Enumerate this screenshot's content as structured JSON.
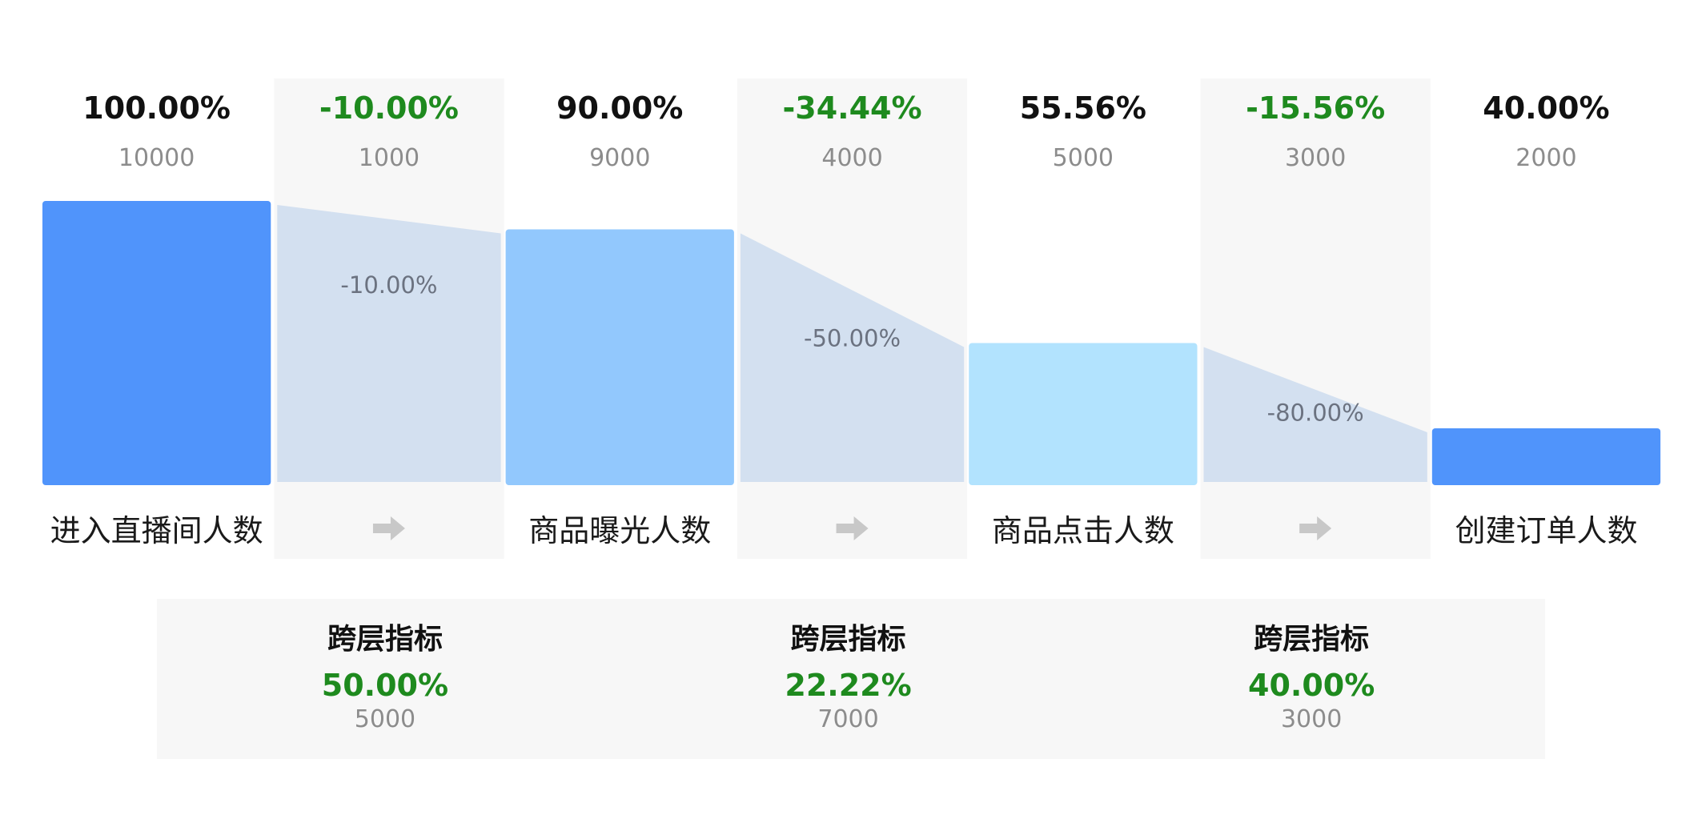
{
  "colors": {
    "green": "#1e8a1e",
    "black": "#111111",
    "panel": "#f7f7f7",
    "connector": "#d3e0f0",
    "arrow": "#c8c8c8",
    "stage_bars": [
      "#5094fb",
      "#92c8fd",
      "#b2e3fe",
      "#5094fb"
    ]
  },
  "chart_data": {
    "type": "funnel",
    "stages": [
      {
        "label": "进入直播间人数",
        "percent": "100.00%",
        "count": 10000,
        "value": 10000
      },
      {
        "label": "商品曝光人数",
        "percent": "90.00%",
        "count": 9000,
        "value": 9000
      },
      {
        "label": "商品点击人数",
        "percent": "55.56%",
        "count": 5000,
        "value": 5000
      },
      {
        "label": "创建订单人数",
        "percent": "40.00%",
        "count": 2000,
        "value": 2000
      }
    ],
    "transitions": [
      {
        "percent": "-10.00%",
        "count": 1000,
        "conversion": "-10.00%",
        "arrow_icon": "arrow-right-icon"
      },
      {
        "percent": "-34.44%",
        "count": 4000,
        "conversion": "-50.00%",
        "arrow_icon": "arrow-right-icon"
      },
      {
        "percent": "-15.56%",
        "count": 3000,
        "conversion": "-80.00%",
        "arrow_icon": "arrow-right-icon"
      }
    ],
    "cross_layer": [
      {
        "title": "跨层指标",
        "percent": "50.00%",
        "count": 5000
      },
      {
        "title": "跨层指标",
        "percent": "22.22%",
        "count": 7000
      },
      {
        "title": "跨层指标",
        "percent": "40.00%",
        "count": 3000
      }
    ],
    "ylim": [
      0,
      10000
    ]
  }
}
